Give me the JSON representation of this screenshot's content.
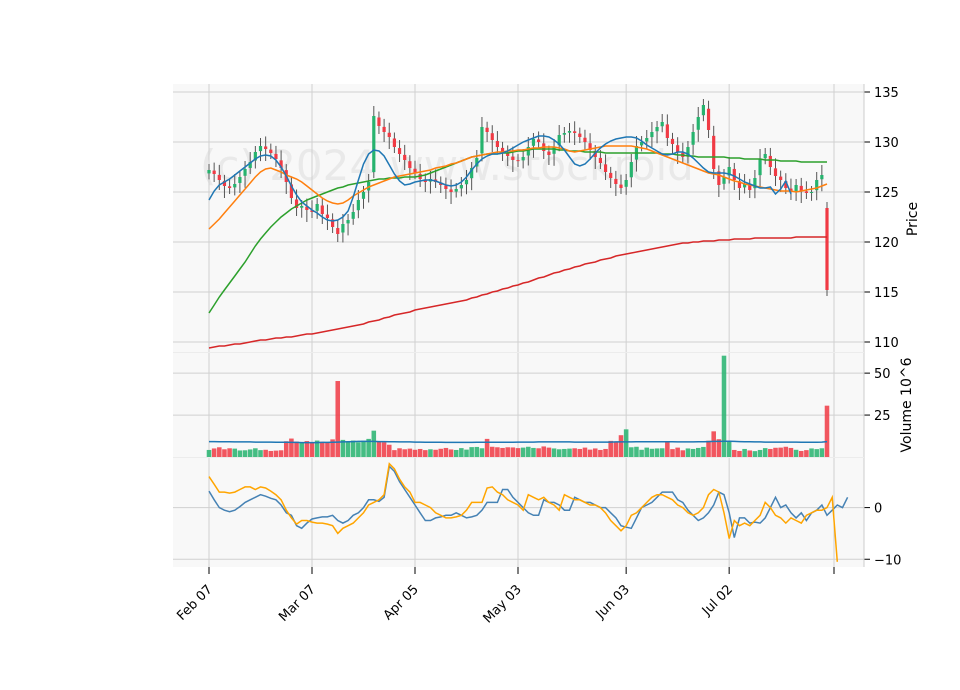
{
  "chart_data": {
    "type": "candlestick",
    "watermark": "(c) 2024 www.stockroid",
    "colors": {
      "up": "#26b36e",
      "down": "#f03a44",
      "panel_bg": "#f8f8f8",
      "grid": "#d0d0d0",
      "ma_short": "#1f77b4",
      "ma_mid": "#ff7f0e",
      "ma_long": "#2ca02c",
      "ma_200": "#d62728",
      "osc_a": "#4682b4",
      "osc_b": "#ffa500",
      "volume_ma": "#1f77b4"
    },
    "x_ticks": [
      {
        "label": "Feb 07",
        "index": 0
      },
      {
        "label": "Mar 07",
        "index": 20
      },
      {
        "label": "Apr 05",
        "index": 40
      },
      {
        "label": "May 03",
        "index": 60
      },
      {
        "label": "Jun 03",
        "index": 81
      },
      {
        "label": "Jul 02",
        "index": 101
      }
    ],
    "n_sessions": 121,
    "price_panel": {
      "ylabel": "Price",
      "ylim": [
        109,
        135.8
      ],
      "y_ticks": [
        110,
        115,
        120,
        125,
        130,
        135
      ],
      "closes": [
        127.2,
        126.8,
        126.2,
        125.6,
        125.4,
        125.8,
        126.5,
        127.3,
        128.0,
        129.0,
        129.6,
        129.3,
        128.9,
        128.3,
        127.4,
        126.0,
        124.4,
        123.4,
        123.6,
        123.2,
        123.0,
        123.8,
        122.8,
        122.4,
        121.5,
        120.8,
        121.8,
        122.2,
        123.0,
        124.2,
        125.0,
        126.0,
        132.6,
        131.6,
        131.0,
        130.5,
        129.5,
        128.8,
        128.2,
        127.4,
        126.9,
        126.3,
        126.0,
        126.3,
        126.0,
        125.7,
        125.3,
        125.0,
        125.3,
        125.7,
        126.2,
        127.4,
        128.4,
        131.5,
        131.0,
        130.2,
        129.5,
        128.9,
        128.6,
        128.2,
        128.1,
        128.5,
        129.5,
        130.3,
        130.0,
        129.1,
        128.7,
        129.5,
        130.7,
        130.9,
        131.1,
        130.9,
        130.5,
        130.0,
        129.2,
        128.5,
        127.9,
        127.0,
        126.4,
        125.8,
        125.4,
        126.2,
        128.0,
        129.6,
        130.0,
        130.4,
        131.0,
        131.5,
        132.0,
        130.4,
        129.8,
        129.0,
        128.5,
        129.5,
        131.0,
        132.5,
        133.7,
        131.2,
        127.3,
        125.7,
        126.5,
        127.5,
        126.2,
        125.4,
        125.8,
        125.2,
        126.4,
        128.3,
        128.8,
        127.5,
        126.6,
        126.2,
        125.4,
        125.0,
        125.7,
        125.1,
        124.9,
        125.0,
        126.2,
        126.7,
        115.2
      ],
      "ma_short": [
        124.2,
        125.1,
        125.7,
        126.0,
        126.3,
        126.7,
        127.1,
        127.5,
        127.9,
        128.3,
        128.6,
        128.7,
        128.6,
        128.2,
        127.5,
        126.6,
        125.6,
        124.7,
        124.0,
        123.6,
        123.2,
        122.9,
        122.5,
        122.2,
        122.1,
        122.2,
        122.5,
        123.1,
        124.5,
        126.2,
        127.8,
        128.8,
        129.2,
        129.1,
        128.6,
        127.7,
        126.8,
        126.1,
        125.7,
        125.8,
        126.0,
        126.1,
        126.2,
        126.2,
        126.1,
        125.9,
        125.7,
        125.6,
        125.7,
        126.0,
        126.5,
        127.2,
        127.8,
        128.3,
        128.6,
        128.8,
        128.8,
        128.9,
        129.1,
        129.4,
        129.7,
        130.0,
        130.2,
        130.4,
        130.6,
        130.6,
        130.5,
        130.2,
        129.8,
        129.2,
        128.5,
        127.8,
        127.6,
        127.8,
        128.3,
        128.9,
        129.4,
        129.8,
        130.1,
        130.3,
        130.4,
        130.5,
        130.5,
        130.4,
        130.1,
        129.7,
        129.4,
        129.1,
        128.8,
        128.7,
        128.8,
        129.0,
        129.0,
        128.8,
        128.4,
        127.9,
        127.4,
        127.0,
        126.9,
        126.9,
        126.9,
        126.8,
        126.6,
        126.3,
        126.0,
        125.8,
        125.6,
        125.4,
        125.4,
        125.5,
        124.8,
        125.3,
        126.1,
        124.8
      ],
      "ma_mid": [
        121.3,
        121.8,
        122.3,
        122.9,
        123.5,
        124.1,
        124.7,
        125.3,
        125.9,
        126.5,
        127.0,
        127.3,
        127.4,
        127.2,
        127.0,
        126.7,
        126.5,
        126.3,
        126.0,
        125.6,
        125.2,
        124.8,
        124.4,
        124.1,
        123.9,
        123.8,
        123.9,
        124.2,
        124.6,
        124.9,
        125.2,
        125.5,
        125.7,
        125.9,
        126.1,
        126.3,
        126.5,
        126.6,
        126.7,
        126.8,
        126.9,
        127.0,
        127.1,
        127.2,
        127.4,
        127.5,
        127.6,
        127.8,
        127.9,
        128.1,
        128.3,
        128.5,
        128.6,
        128.7,
        128.8,
        128.9,
        129.0,
        129.0,
        129.1,
        129.1,
        129.2,
        129.2,
        129.3,
        129.4,
        129.4,
        129.5,
        129.5,
        129.5,
        129.4,
        129.3,
        129.1,
        129.0,
        129.1,
        129.2,
        129.3,
        129.4,
        129.5,
        129.6,
        129.6,
        129.6,
        129.6,
        129.6,
        129.6,
        129.5,
        129.4,
        129.3,
        129.1,
        128.9,
        128.7,
        128.5,
        128.3,
        128.1,
        127.9,
        127.7,
        127.5,
        127.3,
        127.1,
        126.9,
        126.8,
        126.7,
        126.5,
        126.3,
        126.1,
        126.0,
        125.8,
        125.7,
        125.6,
        125.5,
        125.4,
        125.3,
        125.2,
        125.1,
        125.1,
        125.1,
        125.0,
        125.1,
        125.2,
        125.3,
        125.4,
        125.6,
        125.8
      ],
      "ma_long": [
        112.9,
        113.7,
        114.5,
        115.2,
        115.9,
        116.6,
        117.3,
        118.0,
        118.8,
        119.6,
        120.3,
        120.9,
        121.5,
        122.0,
        122.5,
        122.9,
        123.3,
        123.6,
        123.9,
        124.2,
        124.4,
        124.6,
        124.8,
        125.0,
        125.2,
        125.4,
        125.5,
        125.7,
        125.8,
        125.9,
        126.0,
        126.1,
        126.2,
        126.3,
        126.3,
        126.4,
        126.4,
        126.4,
        126.5,
        126.5,
        126.5,
        126.6,
        126.7,
        126.9,
        127.1,
        127.3,
        127.5,
        127.7,
        127.9,
        128.1,
        128.3,
        128.5,
        128.6,
        128.7,
        128.8,
        128.8,
        128.8,
        128.9,
        128.9,
        129.0,
        129.1,
        129.1,
        129.2,
        129.3,
        129.3,
        129.3,
        129.3,
        129.3,
        129.2,
        129.2,
        129.1,
        129.1,
        129.1,
        129.0,
        129.0,
        129.0,
        129.0,
        128.9,
        128.9,
        128.9,
        128.9,
        128.9,
        128.9,
        128.9,
        128.9,
        128.9,
        128.9,
        128.9,
        128.8,
        128.8,
        128.8,
        128.7,
        128.7,
        128.6,
        128.6,
        128.5,
        128.5,
        128.5,
        128.5,
        128.5,
        128.5,
        128.4,
        128.4,
        128.4,
        128.3,
        128.3,
        128.3,
        128.3,
        128.2,
        128.2,
        128.2,
        128.1,
        128.1,
        128.1,
        128.1,
        128.0,
        128.0,
        128.0,
        128.0,
        128.0,
        128.0
      ],
      "ma_200": [
        109.4,
        109.5,
        109.6,
        109.6,
        109.7,
        109.8,
        109.8,
        109.9,
        110.0,
        110.1,
        110.2,
        110.2,
        110.3,
        110.4,
        110.4,
        110.5,
        110.5,
        110.6,
        110.7,
        110.8,
        110.8,
        110.9,
        111.0,
        111.1,
        111.2,
        111.3,
        111.4,
        111.5,
        111.6,
        111.7,
        111.8,
        112.0,
        112.1,
        112.2,
        112.4,
        112.5,
        112.7,
        112.8,
        112.9,
        113.0,
        113.2,
        113.3,
        113.4,
        113.5,
        113.6,
        113.7,
        113.8,
        113.9,
        114.0,
        114.1,
        114.2,
        114.4,
        114.5,
        114.7,
        114.8,
        115.0,
        115.1,
        115.3,
        115.4,
        115.6,
        115.7,
        115.9,
        116.0,
        116.2,
        116.4,
        116.5,
        116.7,
        116.9,
        117.0,
        117.2,
        117.3,
        117.5,
        117.6,
        117.8,
        117.9,
        118.0,
        118.2,
        118.3,
        118.4,
        118.6,
        118.7,
        118.8,
        118.9,
        119.0,
        119.1,
        119.2,
        119.3,
        119.4,
        119.5,
        119.6,
        119.7,
        119.8,
        119.9,
        119.9,
        120.0,
        120.0,
        120.1,
        120.1,
        120.1,
        120.2,
        120.2,
        120.2,
        120.3,
        120.3,
        120.3,
        120.3,
        120.4,
        120.4,
        120.4,
        120.4,
        120.4,
        120.4,
        120.4,
        120.4,
        120.5,
        120.5,
        120.5,
        120.5,
        120.5,
        120.5,
        120.5
      ]
    },
    "volume_panel": {
      "ylabel": "Volume  10^6",
      "ylim": [
        0,
        62
      ],
      "y_ticks": [
        25,
        50
      ],
      "values": [
        4.2,
        5.1,
        5.8,
        4.6,
        5.2,
        5.0,
        3.9,
        4.0,
        4.5,
        5.2,
        4.1,
        4.3,
        3.6,
        3.8,
        4.0,
        9.4,
        11.0,
        9.2,
        8.9,
        9.5,
        8.7,
        9.8,
        9.1,
        8.6,
        10.5,
        45.3,
        10.2,
        9.1,
        9.8,
        8.8,
        9.7,
        10.8,
        15.7,
        9.0,
        8.8,
        7.3,
        4.1,
        5.2,
        4.6,
        5.0,
        4.3,
        4.8,
        4.1,
        4.6,
        4.3,
        4.9,
        5.4,
        4.5,
        4.2,
        5.3,
        4.4,
        5.9,
        6.0,
        5.2,
        10.8,
        6.1,
        5.8,
        5.4,
        5.8,
        5.7,
        5.3,
        5.6,
        6.1,
        5.4,
        5.2,
        6.3,
        5.6,
        5.1,
        4.6,
        4.8,
        5.0,
        5.2,
        4.8,
        5.6,
        4.4,
        5.1,
        4.2,
        4.8,
        9.6,
        8.9,
        13.0,
        16.5,
        5.8,
        6.1,
        4.3,
        5.6,
        4.9,
        5.1,
        5.2,
        9.1,
        4.7,
        5.6,
        4.0,
        5.1,
        4.8,
        5.4,
        6.0,
        9.7,
        15.3,
        10.6,
        60.4,
        9.8,
        4.2,
        3.6,
        4.8,
        3.9,
        3.5,
        4.2,
        5.3,
        4.8,
        5.5,
        5.6,
        6.1,
        5.4,
        4.3,
        3.6,
        4.1,
        5.1,
        4.7,
        5.2,
        30.6
      ],
      "ma": [
        9.2,
        9.2,
        9.1,
        9.1,
        9.1,
        9.0,
        9.0,
        9.0,
        9.0,
        8.9,
        8.9,
        8.9,
        8.9,
        8.8,
        8.8,
        8.8,
        8.7,
        8.7,
        8.6,
        8.6,
        8.6,
        8.6,
        8.7,
        8.7,
        8.8,
        8.9,
        9.0,
        9.1,
        9.2,
        9.3,
        9.3,
        9.3,
        9.3,
        9.2,
        9.2,
        9.1,
        9.1,
        9.0,
        9.0,
        9.0,
        8.9,
        8.9,
        8.8,
        8.8,
        8.8,
        8.8,
        8.7,
        8.7,
        8.7,
        8.7,
        8.7,
        8.7,
        8.8,
        8.8,
        8.8,
        8.8,
        8.8,
        8.8,
        8.8,
        8.8,
        8.9,
        8.9,
        8.9,
        8.9,
        9.0,
        9.0,
        9.0,
        9.0,
        9.0,
        9.0,
        9.0,
        8.9,
        8.9,
        8.9,
        8.9,
        8.9,
        8.9,
        8.9,
        8.9,
        9.0,
        9.0,
        9.0,
        9.0,
        9.1,
        9.1,
        9.1,
        9.1,
        9.1,
        9.1,
        9.1,
        9.1,
        9.0,
        9.0,
        9.0,
        9.0,
        9.1,
        9.1,
        9.2,
        9.3,
        9.3,
        9.4,
        9.4,
        9.3,
        9.2,
        9.1,
        9.1,
        9.0,
        9.0,
        8.9,
        8.9,
        8.9,
        8.9,
        8.9,
        8.9,
        8.9,
        8.8,
        8.8,
        8.8,
        8.8,
        8.9,
        9.2
      ]
    },
    "oscillator_panel": {
      "ylim": [
        -11.5,
        9.6
      ],
      "y_ticks": [
        -10,
        0
      ],
      "line_a": [
        3.2,
        1.5,
        0.0,
        -0.5,
        -0.8,
        -0.5,
        0.2,
        1.0,
        1.5,
        2.0,
        2.5,
        2.2,
        1.8,
        1.5,
        0.5,
        -1.0,
        -1.5,
        -3.5,
        -4.0,
        -3.0,
        -2.2,
        -2.0,
        -1.8,
        -1.8,
        -1.5,
        -2.5,
        -3.0,
        -2.5,
        -1.5,
        -1.0,
        0.0,
        1.5,
        1.5,
        1.2,
        2.0,
        8.0,
        7.0,
        5.0,
        3.5,
        2.0,
        0.5,
        -1.0,
        -2.5,
        -2.5,
        -2.0,
        -1.8,
        -1.5,
        -1.5,
        -1.0,
        -1.5,
        -2.0,
        -1.8,
        -1.5,
        -0.5,
        1.0,
        1.0,
        1.0,
        3.5,
        3.5,
        2.0,
        1.0,
        0.0,
        -1.0,
        -1.5,
        -1.5,
        1.5,
        1.0,
        1.0,
        0.5,
        -0.5,
        -0.5,
        2.0,
        1.5,
        1.0,
        1.0,
        0.5,
        0.0,
        0.0,
        -1.0,
        -2.0,
        -3.5,
        -3.8,
        -4.0,
        -2.0,
        0.0,
        0.5,
        1.0,
        2.0,
        3.0,
        3.0,
        3.0,
        1.5,
        1.0,
        -0.5,
        -1.5,
        -2.5,
        -2.0,
        -1.0,
        0.5,
        3.0,
        2.5,
        -1.0,
        -5.8,
        -2.0,
        -2.0,
        -3.0,
        -2.8,
        -3.0,
        -2.0,
        0.0,
        2.0,
        0.0,
        0.5,
        -1.0,
        -2.0,
        -1.0,
        -2.5,
        -1.0,
        -0.5,
        0.5,
        -1.5,
        -0.5,
        0.5,
        0.0,
        2.0
      ],
      "line_b": [
        6.0,
        4.5,
        3.0,
        3.0,
        2.8,
        3.0,
        3.5,
        4.0,
        4.0,
        3.5,
        4.0,
        3.8,
        3.2,
        2.5,
        1.5,
        -0.5,
        -2.0,
        -3.2,
        -2.5,
        -2.5,
        -2.8,
        -3.0,
        -3.0,
        -3.2,
        -3.5,
        -5.0,
        -4.0,
        -3.5,
        -3.0,
        -2.0,
        -1.0,
        0.5,
        1.0,
        1.5,
        2.5,
        8.5,
        7.5,
        5.5,
        4.0,
        3.0,
        1.0,
        1.0,
        0.5,
        0.0,
        -1.0,
        -1.5,
        -2.0,
        -2.0,
        -1.8,
        -1.5,
        -0.5,
        1.0,
        1.0,
        1.0,
        3.8,
        4.0,
        3.0,
        2.5,
        1.5,
        1.0,
        0.5,
        -0.5,
        2.5,
        2.0,
        1.5,
        2.0,
        1.0,
        0.5,
        -0.5,
        2.5,
        2.0,
        1.5,
        1.5,
        1.0,
        0.5,
        0.5,
        0.0,
        -1.0,
        -2.5,
        -3.5,
        -4.5,
        -3.5,
        -1.5,
        -1.0,
        0.0,
        1.0,
        2.0,
        2.5,
        2.5,
        2.0,
        1.5,
        0.5,
        0.0,
        -1.0,
        -1.5,
        -1.0,
        0.0,
        2.5,
        3.5,
        3.0,
        -1.0,
        -6.0,
        -2.5,
        -3.5,
        -3.0,
        -3.5,
        -2.5,
        -1.5,
        1.0,
        0.0,
        -1.5,
        -2.0,
        -3.0,
        -2.0,
        -2.5,
        -3.0,
        -1.5,
        -1.0,
        -0.5,
        -0.5,
        0.0,
        2.0,
        -10.5
      ]
    }
  }
}
